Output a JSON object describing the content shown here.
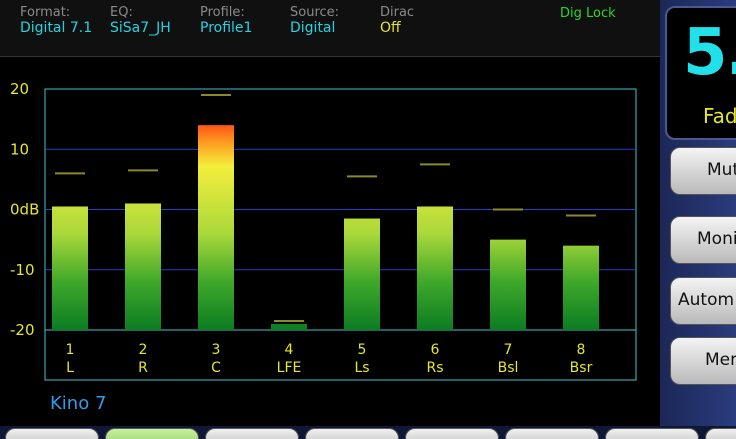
{
  "status": {
    "format": {
      "label": "Format:",
      "value": "Digital 7.1"
    },
    "eq": {
      "label": "EQ:",
      "value": "SiSa7_JH"
    },
    "profile": {
      "label": "Profile:",
      "value": "Profile1"
    },
    "source": {
      "label": "Source:",
      "value": "Digital"
    },
    "dirac": {
      "label": "Dirac",
      "value": "Off"
    },
    "dig_lock": "Dig Lock"
  },
  "chart_data": {
    "type": "bar",
    "ylim": [
      -20,
      20
    ],
    "ytick_labels": [
      "20",
      "10",
      "0dB",
      "-10",
      "-20"
    ],
    "ytick_values": [
      20,
      10,
      0,
      -10,
      -20
    ],
    "categories": [
      {
        "num": "1",
        "name": "L"
      },
      {
        "num": "2",
        "name": "R"
      },
      {
        "num": "3",
        "name": "C"
      },
      {
        "num": "4",
        "name": "LFE"
      },
      {
        "num": "5",
        "name": "Ls"
      },
      {
        "num": "6",
        "name": "Rs"
      },
      {
        "num": "7",
        "name": "Bsl"
      },
      {
        "num": "8",
        "name": "Bsr"
      }
    ],
    "series": [
      {
        "values": [
          0.5,
          1,
          14,
          -19,
          -1.5,
          0.5,
          -5,
          -6
        ]
      },
      {
        "values": [
          6,
          6.5,
          19,
          -18.5,
          5.5,
          7.5,
          0,
          -1
        ]
      }
    ]
  },
  "preset_name": "Kino 7",
  "right_panel": {
    "volume_value": "5.",
    "volume_label": "Fad",
    "buttons": [
      "Mut",
      "Moni",
      "Autom",
      "Mer"
    ]
  },
  "colors": {
    "accent_cyan": "#25d3e0",
    "accent_yellow": "#e6e62c",
    "lock_green": "#2ed52e",
    "preset_blue": "#2f9dea",
    "plot_border": "#3ec6d0",
    "grid_line": "#1f3fd2"
  }
}
